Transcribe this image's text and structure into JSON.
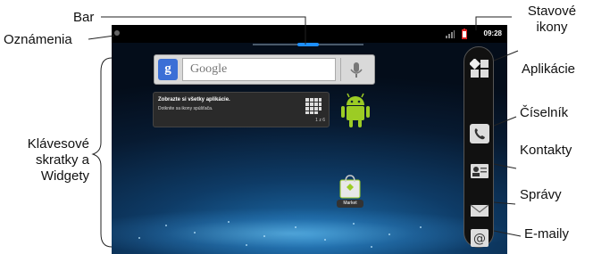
{
  "callouts": {
    "bar": "Bar",
    "notifications": "Oznámenia",
    "status_icons_line1": "Stavové",
    "status_icons_line2": "ikony",
    "shortcuts_line1": "Klávesové",
    "shortcuts_line2": "skratky a",
    "shortcuts_line3": "Widgety",
    "apps": "Aplikácie",
    "dialer": "Číselník",
    "contacts": "Kontakty",
    "messages": "Správy",
    "email": "E-maily"
  },
  "status_bar": {
    "clock": "09:28"
  },
  "search_widget": {
    "placeholder": "Google"
  },
  "tip_widget": {
    "title": "Zobrazte si všetky aplikácie.",
    "subtitle": "Dotknite sa ikony spúšťača.",
    "page": "1 z 6"
  },
  "desktop": {
    "market_label": "Market"
  },
  "colors": {
    "accent_blue": "#1d8fff",
    "android_green": "#9ccc24"
  }
}
